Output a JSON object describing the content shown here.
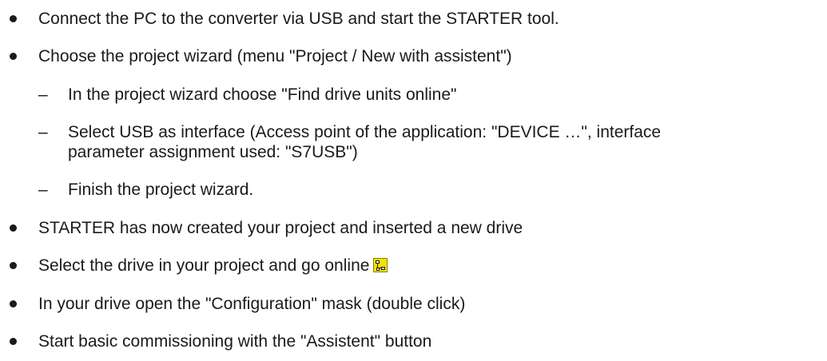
{
  "items": [
    {
      "level": 1,
      "text": "Connect the PC to the converter via USB and start the STARTER tool."
    },
    {
      "level": 1,
      "text": "Choose the project wizard (menu \"Project / New with assistent\")"
    },
    {
      "level": 2,
      "marker": "–",
      "text": "In the project wizard choose \"Find drive units online\""
    },
    {
      "level": 2,
      "marker": "–",
      "text": "Select USB as interface (Access point of the application: \"DEVICE …\", interface",
      "text_cont": "parameter assignment used: \"S7USB\")"
    },
    {
      "level": 2,
      "marker": "–",
      "text": "Finish the project wizard."
    },
    {
      "level": 1,
      "text": "STARTER has now created your project and inserted a new drive"
    },
    {
      "level": 1,
      "text": "Select the drive in your project and go online",
      "icon": "go-online-icon"
    },
    {
      "level": 1,
      "text": "In your drive open the \"Configuration\" mask (double click)"
    },
    {
      "level": 1,
      "text": "Start basic commissioning with the \"Assistent\" button"
    }
  ]
}
